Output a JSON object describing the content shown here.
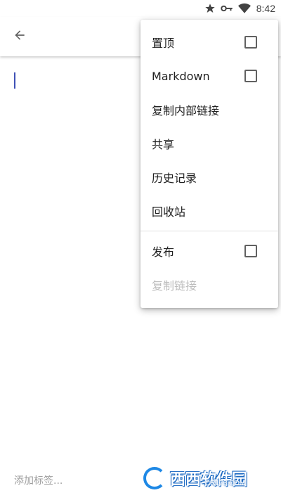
{
  "status_bar": {
    "time": "8:42"
  },
  "toolbar": {
    "back_icon": "arrow-back-icon"
  },
  "editor": {
    "tag_placeholder": "添加标签..."
  },
  "menu": {
    "items": [
      {
        "label": "置顶",
        "checkbox": true,
        "checked": false,
        "enabled": true
      },
      {
        "label": "Markdown",
        "checkbox": true,
        "checked": false,
        "enabled": true
      },
      {
        "label": "复制内部链接",
        "checkbox": false,
        "enabled": true
      },
      {
        "label": "共享",
        "checkbox": false,
        "enabled": true
      },
      {
        "label": "历史记录",
        "checkbox": false,
        "enabled": true
      },
      {
        "label": "回收站",
        "checkbox": false,
        "enabled": true
      },
      {
        "label": "发布",
        "checkbox": true,
        "checked": false,
        "enabled": true
      },
      {
        "label": "复制链接",
        "checkbox": false,
        "enabled": false
      }
    ]
  },
  "watermark": {
    "brand": "西西软件园",
    "domain": "CR173.COM"
  },
  "colors": {
    "accent": "#3f51b5",
    "disabled_text": "#bdbdbd"
  }
}
